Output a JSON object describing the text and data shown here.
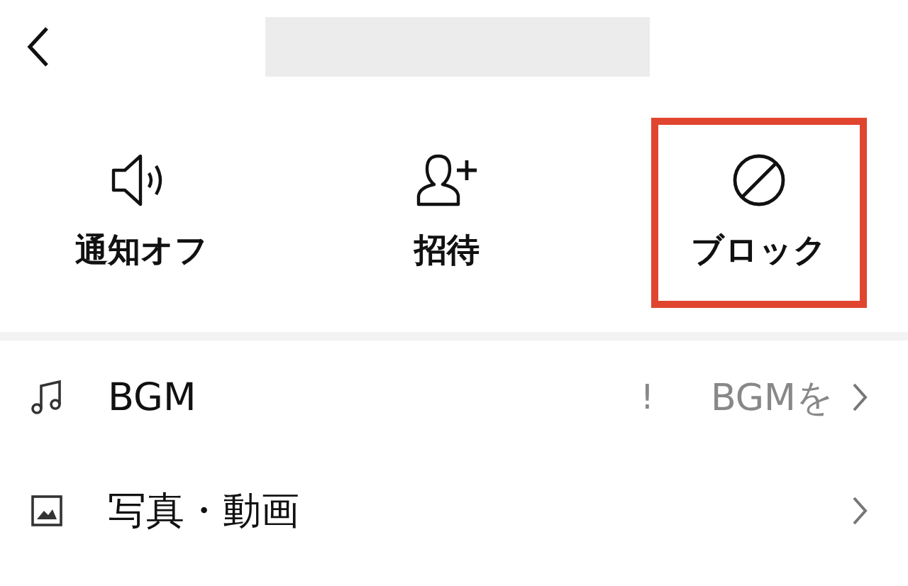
{
  "actions": [
    {
      "label": "通知オフ",
      "highlighted": false
    },
    {
      "label": "招待",
      "highlighted": false
    },
    {
      "label": "ブロック",
      "highlighted": true
    }
  ],
  "rows": [
    {
      "label": "BGM",
      "alert": "!",
      "value": "BGMを"
    },
    {
      "label": "写真・動画"
    }
  ]
}
